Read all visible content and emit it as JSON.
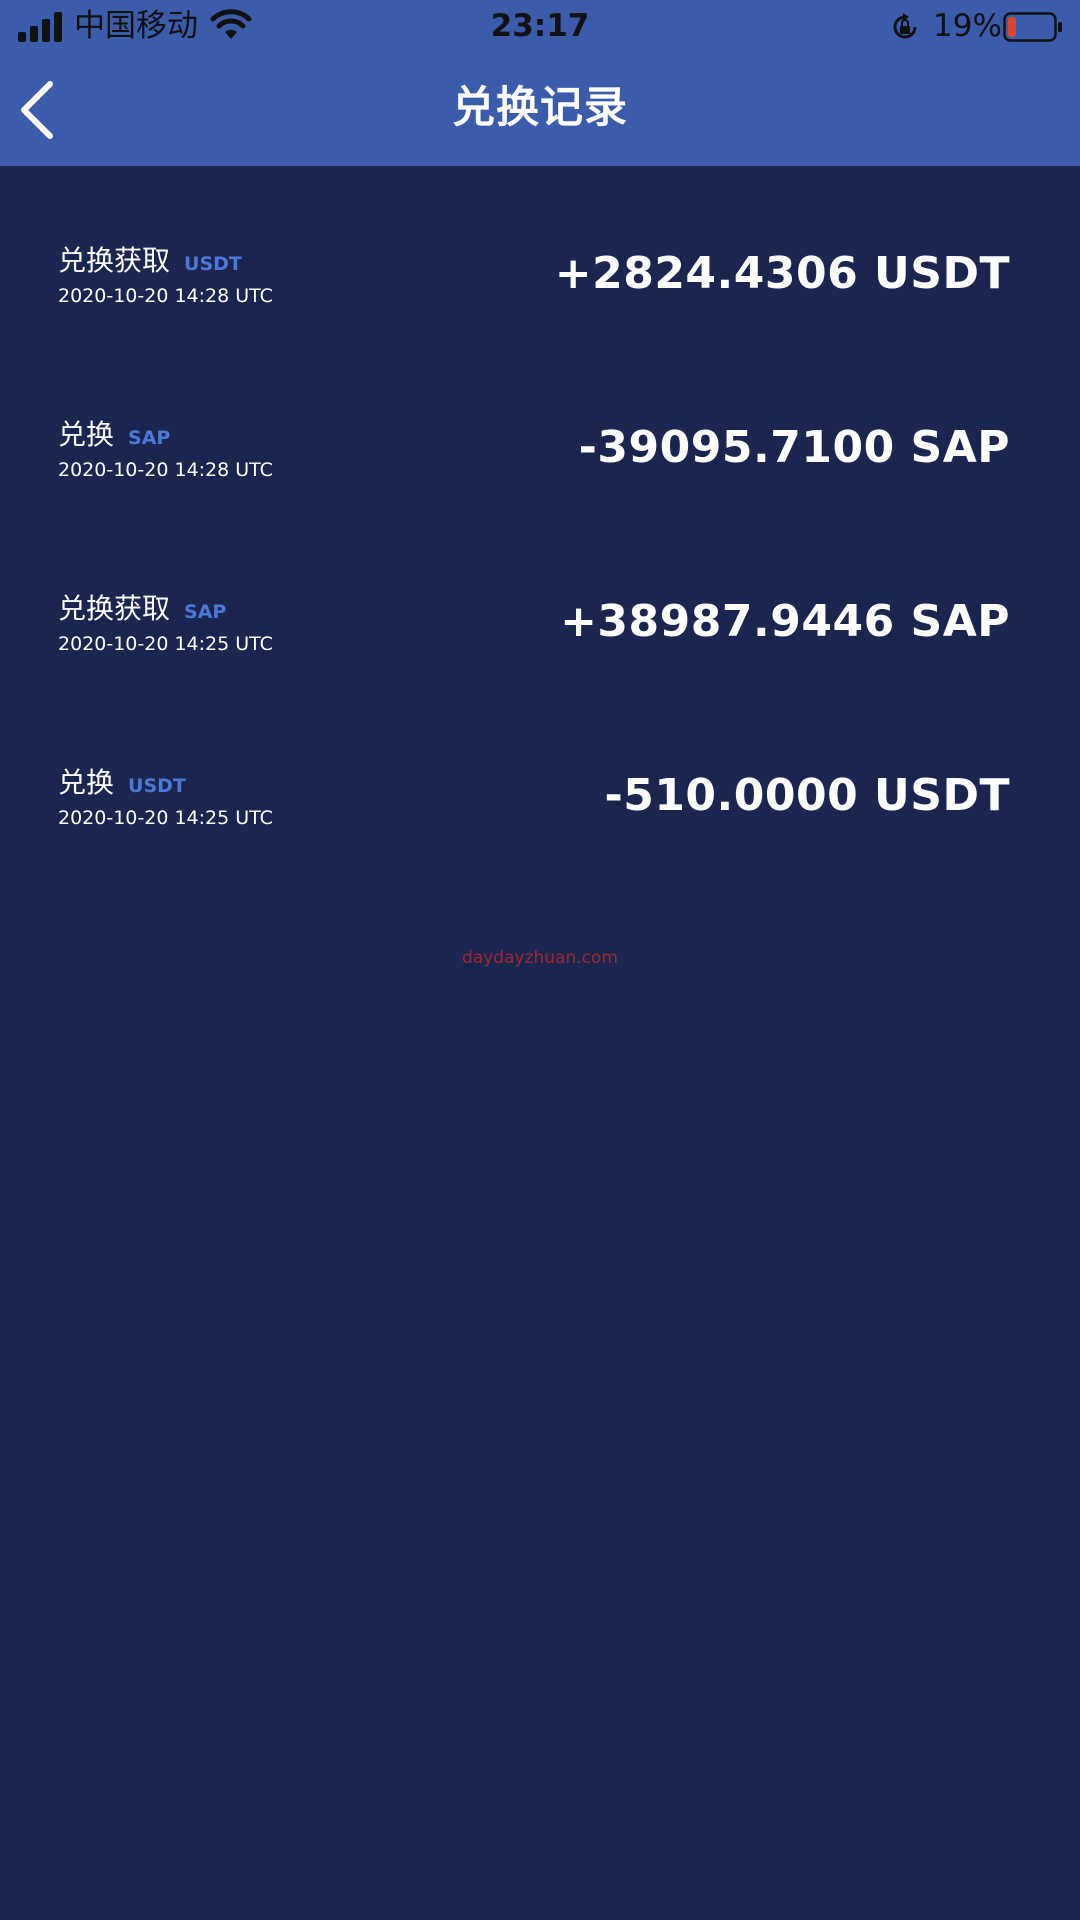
{
  "status_bar": {
    "carrier": "中国移动",
    "time": "23:17",
    "battery_percent": "19%",
    "battery_level": 0.19
  },
  "header": {
    "title": "兑换记录"
  },
  "records": [
    {
      "type": "兑换获取",
      "coin": "USDT",
      "time": "2020-10-20 14:28 UTC",
      "amount": "+2824.4306 USDT"
    },
    {
      "type": "兑换",
      "coin": "SAP",
      "time": "2020-10-20 14:28 UTC",
      "amount": "-39095.7100 SAP"
    },
    {
      "type": "兑换获取",
      "coin": "SAP",
      "time": "2020-10-20 14:25 UTC",
      "amount": "+38987.9446 SAP"
    },
    {
      "type": "兑换",
      "coin": "USDT",
      "time": "2020-10-20 14:25 UTC",
      "amount": "-510.0000 USDT"
    }
  ],
  "watermark": "daydayzhuan.com",
  "colors": {
    "header_bg": "#3b5bab",
    "page_bg": "#1b2650",
    "coin_tag": "#4d78d6",
    "battery_low": "#e0452f"
  }
}
